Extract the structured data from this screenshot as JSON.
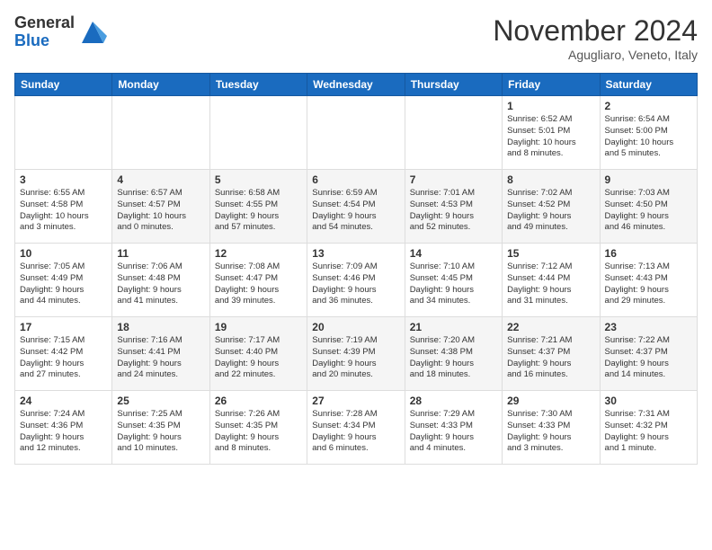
{
  "logo": {
    "line1": "General",
    "line2": "Blue"
  },
  "header": {
    "month": "November 2024",
    "location": "Agugliaro, Veneto, Italy"
  },
  "weekdays": [
    "Sunday",
    "Monday",
    "Tuesday",
    "Wednesday",
    "Thursday",
    "Friday",
    "Saturday"
  ],
  "weeks": [
    [
      {
        "day": "",
        "info": ""
      },
      {
        "day": "",
        "info": ""
      },
      {
        "day": "",
        "info": ""
      },
      {
        "day": "",
        "info": ""
      },
      {
        "day": "",
        "info": ""
      },
      {
        "day": "1",
        "info": "Sunrise: 6:52 AM\nSunset: 5:01 PM\nDaylight: 10 hours\nand 8 minutes."
      },
      {
        "day": "2",
        "info": "Sunrise: 6:54 AM\nSunset: 5:00 PM\nDaylight: 10 hours\nand 5 minutes."
      }
    ],
    [
      {
        "day": "3",
        "info": "Sunrise: 6:55 AM\nSunset: 4:58 PM\nDaylight: 10 hours\nand 3 minutes."
      },
      {
        "day": "4",
        "info": "Sunrise: 6:57 AM\nSunset: 4:57 PM\nDaylight: 10 hours\nand 0 minutes."
      },
      {
        "day": "5",
        "info": "Sunrise: 6:58 AM\nSunset: 4:55 PM\nDaylight: 9 hours\nand 57 minutes."
      },
      {
        "day": "6",
        "info": "Sunrise: 6:59 AM\nSunset: 4:54 PM\nDaylight: 9 hours\nand 54 minutes."
      },
      {
        "day": "7",
        "info": "Sunrise: 7:01 AM\nSunset: 4:53 PM\nDaylight: 9 hours\nand 52 minutes."
      },
      {
        "day": "8",
        "info": "Sunrise: 7:02 AM\nSunset: 4:52 PM\nDaylight: 9 hours\nand 49 minutes."
      },
      {
        "day": "9",
        "info": "Sunrise: 7:03 AM\nSunset: 4:50 PM\nDaylight: 9 hours\nand 46 minutes."
      }
    ],
    [
      {
        "day": "10",
        "info": "Sunrise: 7:05 AM\nSunset: 4:49 PM\nDaylight: 9 hours\nand 44 minutes."
      },
      {
        "day": "11",
        "info": "Sunrise: 7:06 AM\nSunset: 4:48 PM\nDaylight: 9 hours\nand 41 minutes."
      },
      {
        "day": "12",
        "info": "Sunrise: 7:08 AM\nSunset: 4:47 PM\nDaylight: 9 hours\nand 39 minutes."
      },
      {
        "day": "13",
        "info": "Sunrise: 7:09 AM\nSunset: 4:46 PM\nDaylight: 9 hours\nand 36 minutes."
      },
      {
        "day": "14",
        "info": "Sunrise: 7:10 AM\nSunset: 4:45 PM\nDaylight: 9 hours\nand 34 minutes."
      },
      {
        "day": "15",
        "info": "Sunrise: 7:12 AM\nSunset: 4:44 PM\nDaylight: 9 hours\nand 31 minutes."
      },
      {
        "day": "16",
        "info": "Sunrise: 7:13 AM\nSunset: 4:43 PM\nDaylight: 9 hours\nand 29 minutes."
      }
    ],
    [
      {
        "day": "17",
        "info": "Sunrise: 7:15 AM\nSunset: 4:42 PM\nDaylight: 9 hours\nand 27 minutes."
      },
      {
        "day": "18",
        "info": "Sunrise: 7:16 AM\nSunset: 4:41 PM\nDaylight: 9 hours\nand 24 minutes."
      },
      {
        "day": "19",
        "info": "Sunrise: 7:17 AM\nSunset: 4:40 PM\nDaylight: 9 hours\nand 22 minutes."
      },
      {
        "day": "20",
        "info": "Sunrise: 7:19 AM\nSunset: 4:39 PM\nDaylight: 9 hours\nand 20 minutes."
      },
      {
        "day": "21",
        "info": "Sunrise: 7:20 AM\nSunset: 4:38 PM\nDaylight: 9 hours\nand 18 minutes."
      },
      {
        "day": "22",
        "info": "Sunrise: 7:21 AM\nSunset: 4:37 PM\nDaylight: 9 hours\nand 16 minutes."
      },
      {
        "day": "23",
        "info": "Sunrise: 7:22 AM\nSunset: 4:37 PM\nDaylight: 9 hours\nand 14 minutes."
      }
    ],
    [
      {
        "day": "24",
        "info": "Sunrise: 7:24 AM\nSunset: 4:36 PM\nDaylight: 9 hours\nand 12 minutes."
      },
      {
        "day": "25",
        "info": "Sunrise: 7:25 AM\nSunset: 4:35 PM\nDaylight: 9 hours\nand 10 minutes."
      },
      {
        "day": "26",
        "info": "Sunrise: 7:26 AM\nSunset: 4:35 PM\nDaylight: 9 hours\nand 8 minutes."
      },
      {
        "day": "27",
        "info": "Sunrise: 7:28 AM\nSunset: 4:34 PM\nDaylight: 9 hours\nand 6 minutes."
      },
      {
        "day": "28",
        "info": "Sunrise: 7:29 AM\nSunset: 4:33 PM\nDaylight: 9 hours\nand 4 minutes."
      },
      {
        "day": "29",
        "info": "Sunrise: 7:30 AM\nSunset: 4:33 PM\nDaylight: 9 hours\nand 3 minutes."
      },
      {
        "day": "30",
        "info": "Sunrise: 7:31 AM\nSunset: 4:32 PM\nDaylight: 9 hours\nand 1 minute."
      }
    ]
  ]
}
